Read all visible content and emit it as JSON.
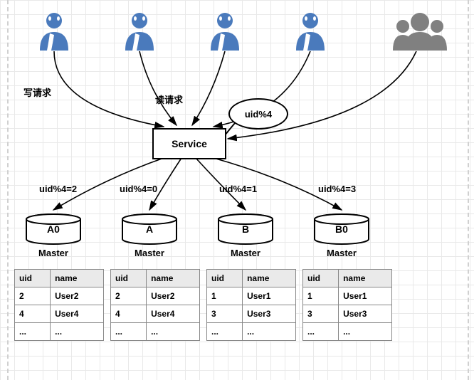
{
  "service_label": "Service",
  "speech_label": "uid%4",
  "write_label": "写请求",
  "read_label": "读请求",
  "branch_labels": [
    "uid%4=2",
    "uid%4=0",
    "uid%4=1",
    "uid%4=3"
  ],
  "db_names": [
    "A0",
    "A",
    "B",
    "B0"
  ],
  "master_label": "Master",
  "cols": [
    "uid",
    "name"
  ],
  "tables": [
    [
      [
        "2",
        "User2"
      ],
      [
        "4",
        "User4"
      ],
      [
        "...",
        "..."
      ]
    ],
    [
      [
        "2",
        "User2"
      ],
      [
        "4",
        "User4"
      ],
      [
        "...",
        "..."
      ]
    ],
    [
      [
        "1",
        "User1"
      ],
      [
        "3",
        "User3"
      ],
      [
        "...",
        "..."
      ]
    ],
    [
      [
        "1",
        "User1"
      ],
      [
        "3",
        "User3"
      ],
      [
        "...",
        "..."
      ]
    ]
  ],
  "colors": {
    "user": "#4a7abc",
    "group": "#808080",
    "db_fill": "#ffffff",
    "db_stroke": "#000000"
  },
  "chart_data": {
    "type": "diagram",
    "description": "Database sharding by uid%4. Service routes read/write requests to 4 master DBs.",
    "routing": [
      {
        "condition": "uid%4=2",
        "target": "A0"
      },
      {
        "condition": "uid%4=0",
        "target": "A"
      },
      {
        "condition": "uid%4=1",
        "target": "B"
      },
      {
        "condition": "uid%4=3",
        "target": "B0"
      }
    ],
    "masters": [
      {
        "name": "A0",
        "role": "Master",
        "rows": [
          {
            "uid": 2,
            "name": "User2"
          },
          {
            "uid": 4,
            "name": "User4"
          }
        ]
      },
      {
        "name": "A",
        "role": "Master",
        "rows": [
          {
            "uid": 2,
            "name": "User2"
          },
          {
            "uid": 4,
            "name": "User4"
          }
        ]
      },
      {
        "name": "B",
        "role": "Master",
        "rows": [
          {
            "uid": 1,
            "name": "User1"
          },
          {
            "uid": 3,
            "name": "User3"
          }
        ]
      },
      {
        "name": "B0",
        "role": "Master",
        "rows": [
          {
            "uid": 1,
            "name": "User1"
          },
          {
            "uid": 3,
            "name": "User3"
          }
        ]
      }
    ]
  }
}
